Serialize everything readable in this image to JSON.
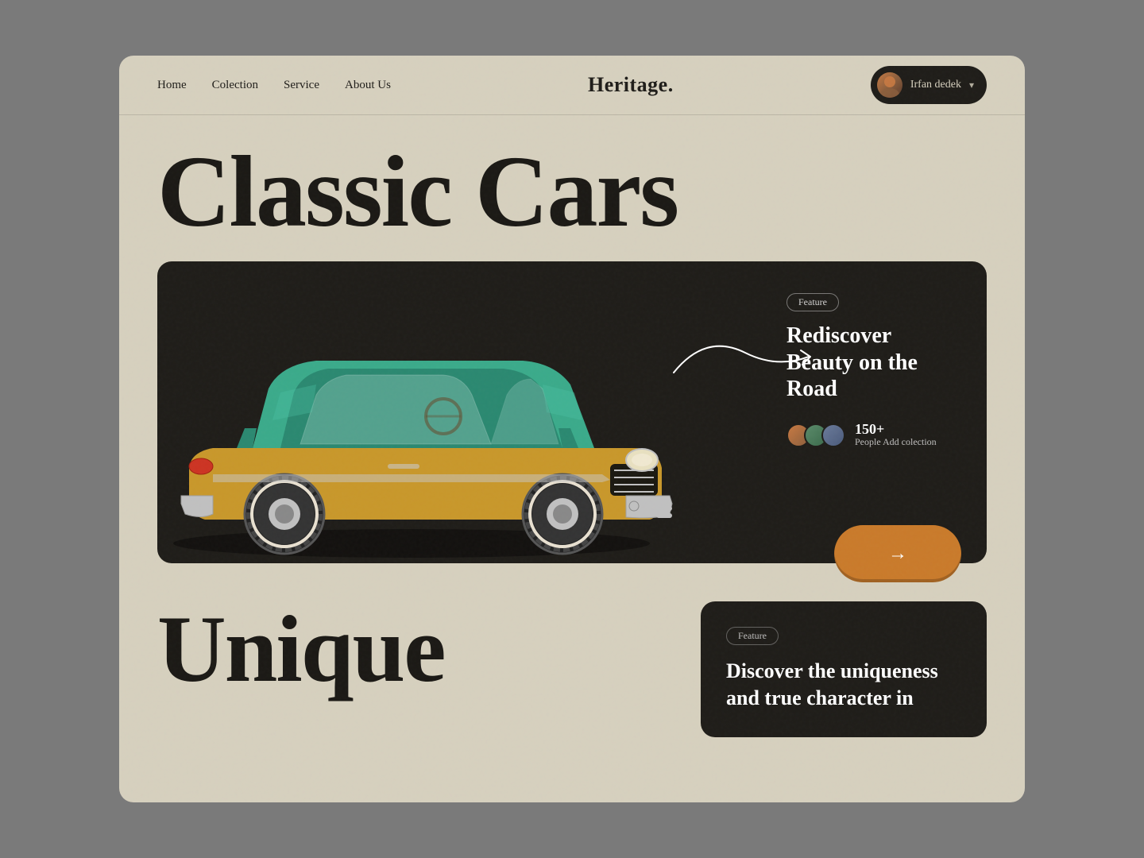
{
  "navbar": {
    "links": [
      {
        "label": "Home",
        "id": "home"
      },
      {
        "label": "Colection",
        "id": "collection"
      },
      {
        "label": "Service",
        "id": "service"
      },
      {
        "label": "About Us",
        "id": "about"
      }
    ],
    "logo": "Heritage.",
    "user": {
      "name": "Irfan dedek",
      "chevron": "▾"
    }
  },
  "hero": {
    "title": "Classic Cars"
  },
  "feature_card": {
    "badge": "Feature",
    "title": "Rediscover Beauty on the Road",
    "people_count": "150+",
    "people_label": "People Add",
    "people_sublabel": "colection"
  },
  "cta": {
    "arrow": "→"
  },
  "bottom_section": {
    "title": "Unique",
    "card": {
      "badge": "Feature",
      "description": "Discover the uniqueness and true character in"
    }
  }
}
